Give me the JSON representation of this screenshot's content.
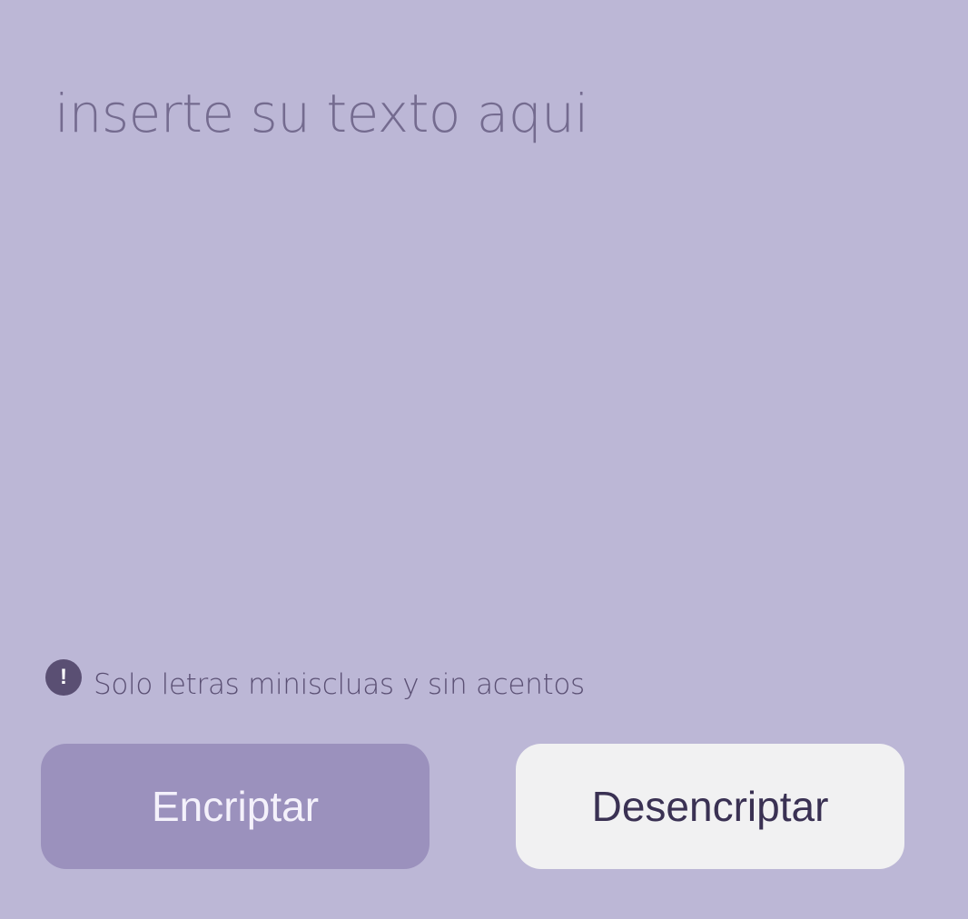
{
  "input": {
    "placeholder": "inserte su texto aqui",
    "value": ""
  },
  "hint": {
    "icon": "exclamation-circle-icon",
    "icon_glyph": "!",
    "text": "Solo letras miniscluas y sin acentos"
  },
  "buttons": {
    "encrypt_label": "Encriptar",
    "decrypt_label": "Desencriptar"
  },
  "colors": {
    "background": "#bcb7d6",
    "encrypt_button": "#9b91bd",
    "decrypt_button": "#f1f1f2",
    "text_dark": "#3a3153",
    "hint_icon": "#5a4f73"
  }
}
